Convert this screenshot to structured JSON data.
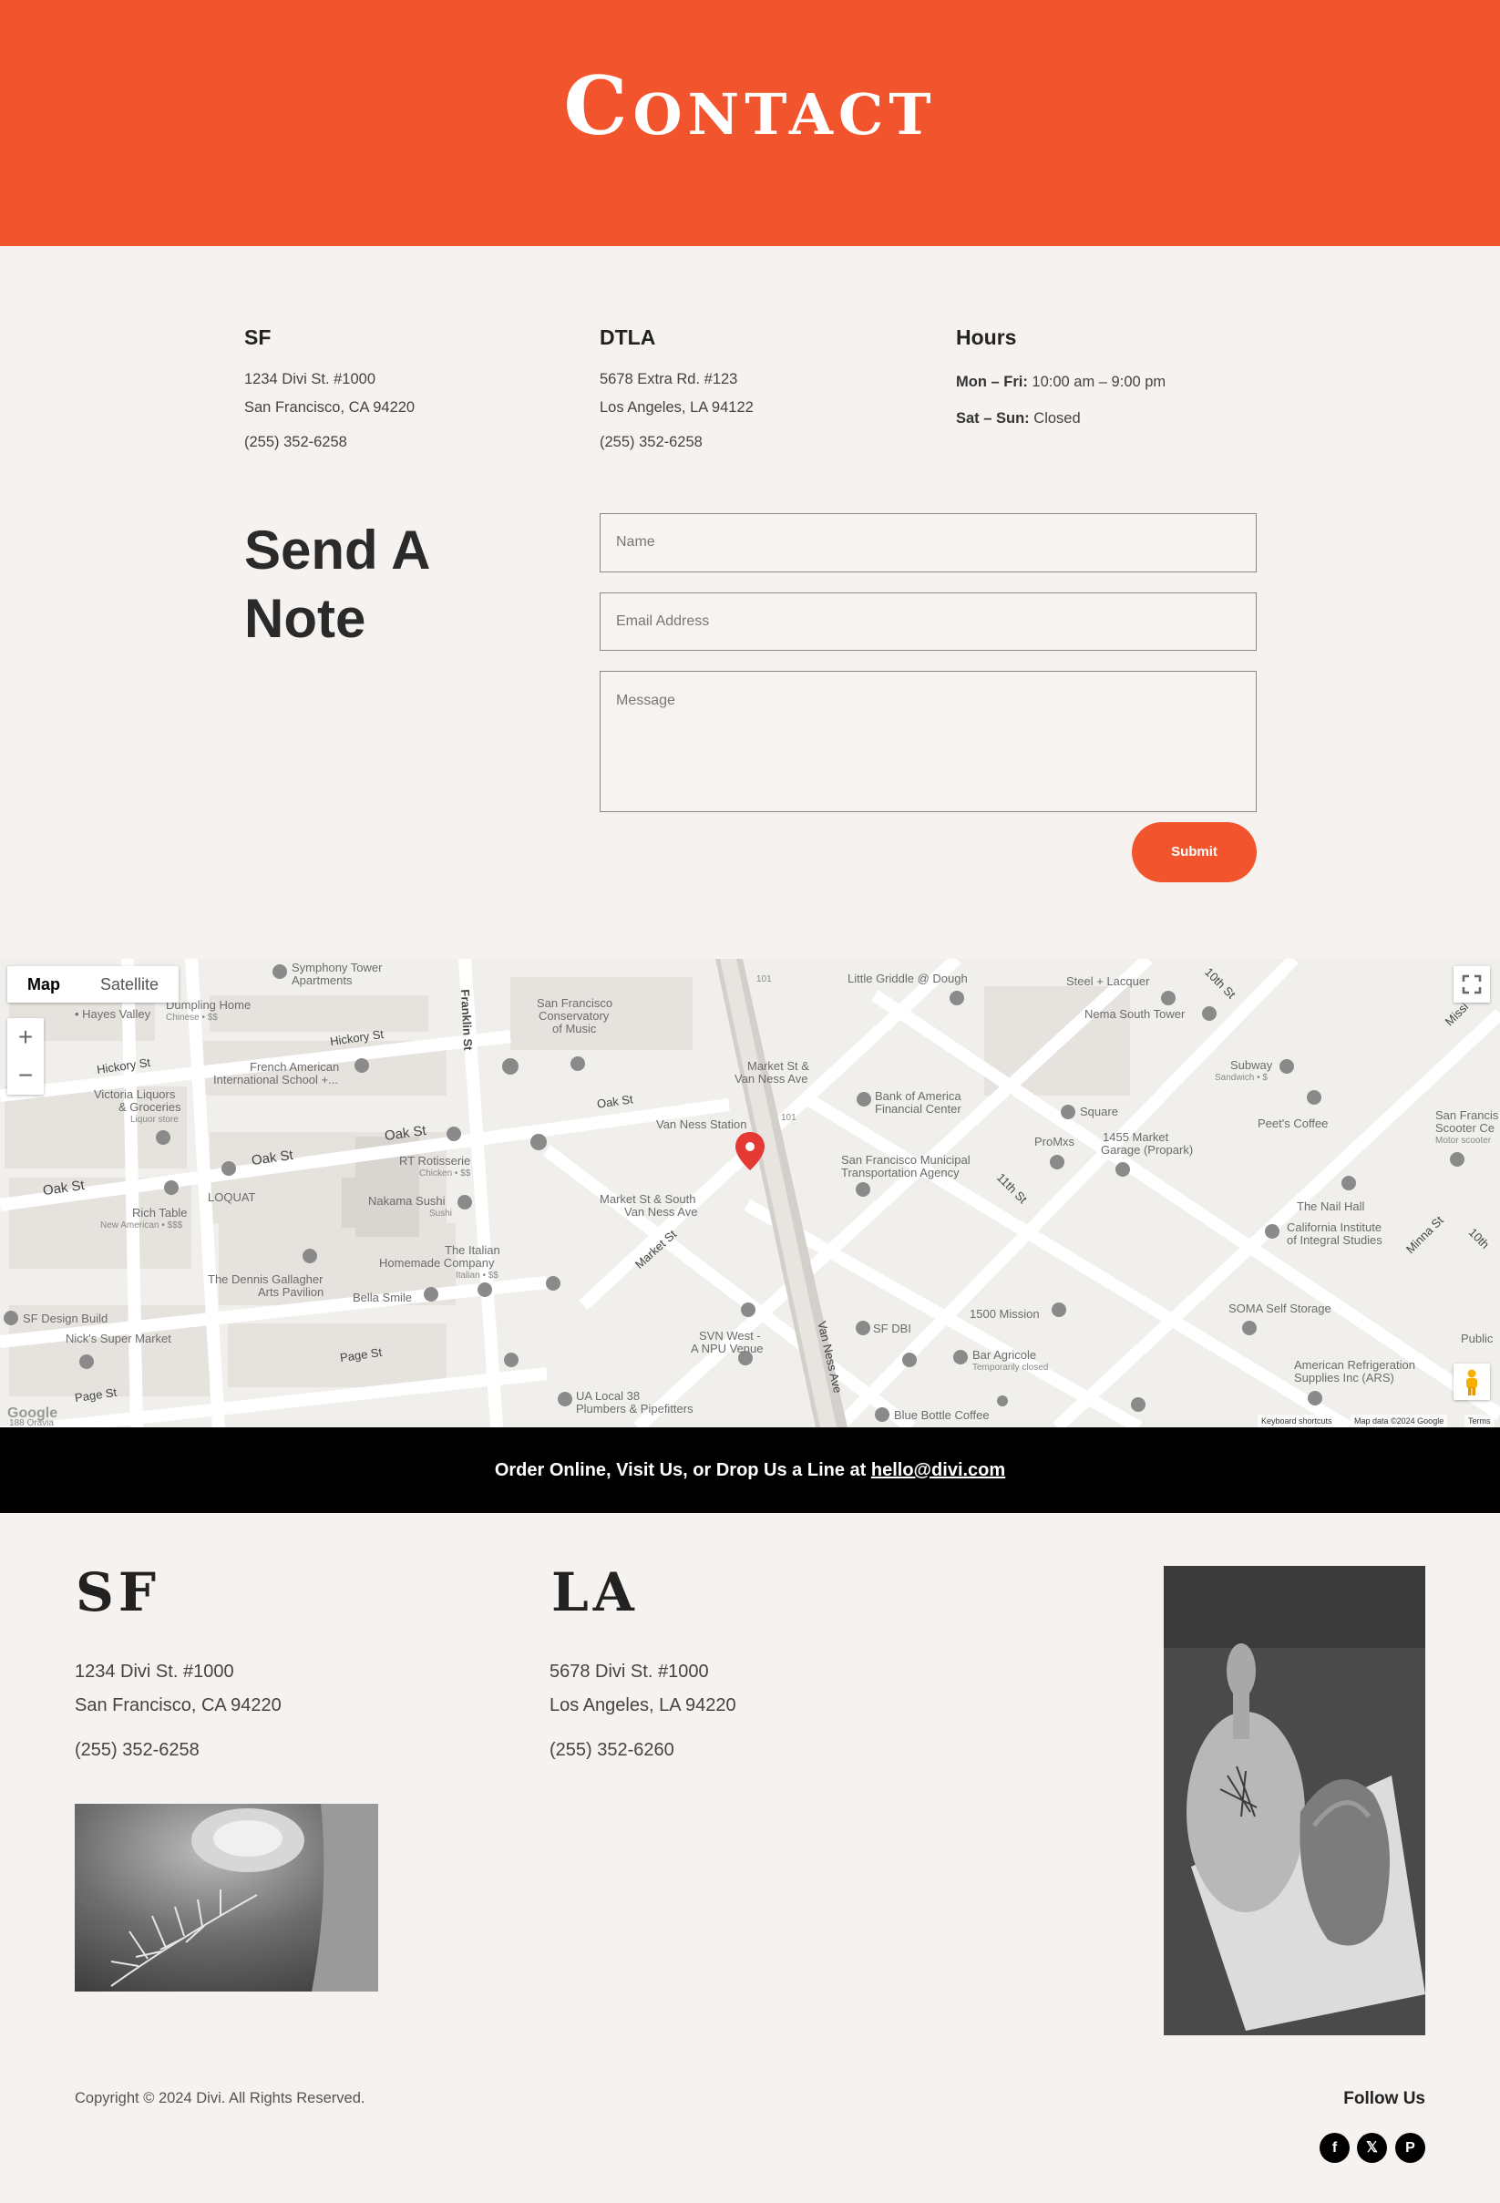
{
  "hero": {
    "title": "Contact"
  },
  "locations": [
    {
      "name": "SF",
      "address1": "1234 Divi St. #1000",
      "address2": "San Francisco, CA 94220",
      "phone": "(255) 352-6258"
    },
    {
      "name": "DTLA",
      "address1": "5678 Extra Rd. #123",
      "address2": "Los Angeles, LA 94122",
      "phone": "(255) 352-6258"
    }
  ],
  "hours": {
    "heading": "Hours",
    "weekday_label": "Mon – Fri:",
    "weekday_value": " 10:00 am – 9:00 pm",
    "weekend_label": "Sat – Sun:",
    "weekend_value": " Closed"
  },
  "form": {
    "title_line1": "Send A",
    "title_line2": "Note",
    "name_placeholder": "Name",
    "email_placeholder": "Email Address",
    "message_placeholder": "Message",
    "submit_label": "Submit"
  },
  "map": {
    "tab_map": "Map",
    "tab_satellite": "Satellite",
    "zoom_in": "+",
    "zoom_out": "−",
    "google_logo": "Google",
    "attribution_shortcuts": "Keyboard shortcuts",
    "attribution_data": "Map data ©2024 Google",
    "attribution_terms": "Terms",
    "places": {
      "symphony": "Symphony Tower",
      "symphony2": "Apartments",
      "hayes": "• Hayes Valley",
      "dumpling": "Dumpling Home",
      "dumpling_sub": "Chinese • $$",
      "hickory1": "Hickory St",
      "hickory2": "Hickory St",
      "french1": "French American",
      "french2": "International School +...",
      "victoria1": "Victoria Liquors",
      "victoria2": "& Groceries",
      "victoria3": "Liquor store",
      "franklin": "Franklin St",
      "conservatory1": "San Francisco",
      "conservatory2": "Conservatory",
      "conservatory3": "of Music",
      "oak1": "Oak St",
      "oak2": "Oak St",
      "oak3": "Oak St",
      "oak4": "Oak St",
      "rt1": "RT Rotisserie",
      "rt2": "Chicken • $$",
      "loquat": "LOQUAT",
      "richtable1": "Rich Table",
      "richtable2": "New American • $$$",
      "nakama1": "Nakama Sushi",
      "nakama2": "Sushi",
      "italian1": "The Italian",
      "italian2": "Homemade Company",
      "italian3": "Italian • $$",
      "dennis1": "The Dennis Gallagher",
      "dennis2": "Arts Pavilion",
      "bella": "Bella Smile",
      "sfdesign": "SF Design Build",
      "nicks": "Nick's Super Market",
      "page1": "Page St",
      "page2": "Page St",
      "oravia": "188 Oravia",
      "vanness_station": "Van Ness Station",
      "market_vanness1": "Market St &",
      "market_vanness2": "Van Ness Ave",
      "market_south1": "Market St & South",
      "market_south2": "Van Ness Ave",
      "market_st": "Market St",
      "svn1": "SVN West -",
      "svn2": "A NPU Venue",
      "ua1": "UA Local 38",
      "ua2": "Plumbers & Pipefitters",
      "vanness_ave": "Van Ness Ave",
      "route101a": "101",
      "route101b": "101",
      "little": "Little Griddle @ Dough",
      "steel": "Steel + Lacquer",
      "nema": "Nema South Tower",
      "tenth1": "10th St",
      "tenth2": "10th",
      "mission": "Missi",
      "bofa1": "Bank of America",
      "bofa2": "Financial Center",
      "muni1": "San Francisco Municipal",
      "muni2": "Transportation Agency",
      "square": "Square",
      "promxs": "ProMxs",
      "garage1": "1455 Market",
      "garage2": "Garage (Propark)",
      "eleventh": "11th St",
      "subway1": "Subway",
      "subway2": "Sandwich • $",
      "peets": "Peet's Coffee",
      "scooter1": "San Francis",
      "scooter2": "Scooter Ce",
      "scooter3": "Motor scooter",
      "nail": "The Nail Hall",
      "ciis1": "California Institute",
      "ciis2": "of Integral Studies",
      "minna": "Minna St",
      "mission1500": "1500 Mission",
      "sfdbi": "SF DBI",
      "agricole1": "Bar Agricole",
      "agricole2": "Temporarily closed",
      "soma": "SOMA Self Storage",
      "public": "Public",
      "refrig1": "American Refrigeration",
      "refrig2": "Supplies Inc (ARS)",
      "bluebottle": "Blue Bottle Coffee"
    }
  },
  "banner": {
    "text": "Order Online, Visit Us, or Drop Us a Line at ",
    "email": "hello@divi.com"
  },
  "footer": {
    "sf": {
      "title": "SF",
      "address1": "1234 Divi St. #1000",
      "address2": "San Francisco, CA 94220",
      "phone": "(255) 352-6258"
    },
    "la": {
      "title": "LA",
      "address1": "5678 Divi St. #1000",
      "address2": "Los Angeles, LA 94220",
      "phone": "(255) 352-6260"
    },
    "copyright": "Copyright © 2024 Divi. All Rights Reserved.",
    "follow": "Follow Us",
    "social": [
      "f",
      "𝕏",
      "P"
    ]
  },
  "colors": {
    "accent": "#f2552d",
    "background": "#f5f2ef",
    "banner": "#000000",
    "map_pin": "#e53935"
  }
}
